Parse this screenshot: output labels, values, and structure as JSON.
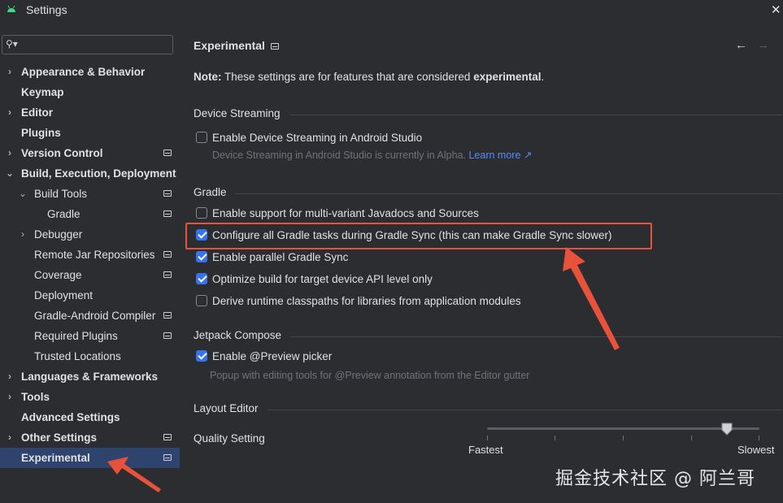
{
  "window": {
    "title": "Settings"
  },
  "search": {
    "placeholder": "",
    "value": ""
  },
  "sidebar": {
    "items": [
      {
        "label": "Appearance & Behavior"
      },
      {
        "label": "Keymap"
      },
      {
        "label": "Editor"
      },
      {
        "label": "Plugins"
      },
      {
        "label": "Version Control"
      },
      {
        "label": "Build, Execution, Deployment"
      },
      {
        "label": "Build Tools"
      },
      {
        "label": "Gradle"
      },
      {
        "label": "Debugger"
      },
      {
        "label": "Remote Jar Repositories"
      },
      {
        "label": "Coverage"
      },
      {
        "label": "Deployment"
      },
      {
        "label": "Gradle-Android Compiler"
      },
      {
        "label": "Required Plugins"
      },
      {
        "label": "Trusted Locations"
      },
      {
        "label": "Languages & Frameworks"
      },
      {
        "label": "Tools"
      },
      {
        "label": "Advanced Settings"
      },
      {
        "label": "Other Settings"
      },
      {
        "label": "Experimental"
      }
    ]
  },
  "main": {
    "title": "Experimental",
    "note": {
      "prefix": "Note:",
      "text": " These settings are for features that are considered ",
      "emph": "experimental",
      "suffix": "."
    },
    "device_streaming": {
      "header": "Device Streaming",
      "enable_label": "Enable Device Streaming in Android Studio",
      "hint": "Device Streaming in Android Studio is currently in Alpha.",
      "learn_more": "Learn more ↗"
    },
    "gradle": {
      "header": "Gradle",
      "options": [
        {
          "label": "Enable support for multi-variant Javadocs and Sources",
          "checked": false
        },
        {
          "label": "Configure all Gradle tasks during Gradle Sync (this can make Gradle Sync slower)",
          "checked": true
        },
        {
          "label": "Enable parallel Gradle Sync",
          "checked": true
        },
        {
          "label": "Optimize build for target device API level only",
          "checked": true
        },
        {
          "label": "Derive runtime classpaths for libraries from application modules",
          "checked": false
        }
      ]
    },
    "jetpack_compose": {
      "header": "Jetpack Compose",
      "enable_label": "Enable @Preview picker",
      "hint": "Popup with editing tools for @Preview annotation from the Editor gutter"
    },
    "layout_editor": {
      "header": "Layout Editor",
      "quality_label": "Quality Setting",
      "slider_min": "Fastest",
      "slider_max": "Slowest",
      "slider_value_fraction": 0.88
    }
  },
  "watermark": "掘金技术社区 @ 阿兰哥",
  "colors": {
    "accent": "#3574f0",
    "selected": "#2e436e",
    "annotation": "#e8513a",
    "link": "#548af7"
  }
}
